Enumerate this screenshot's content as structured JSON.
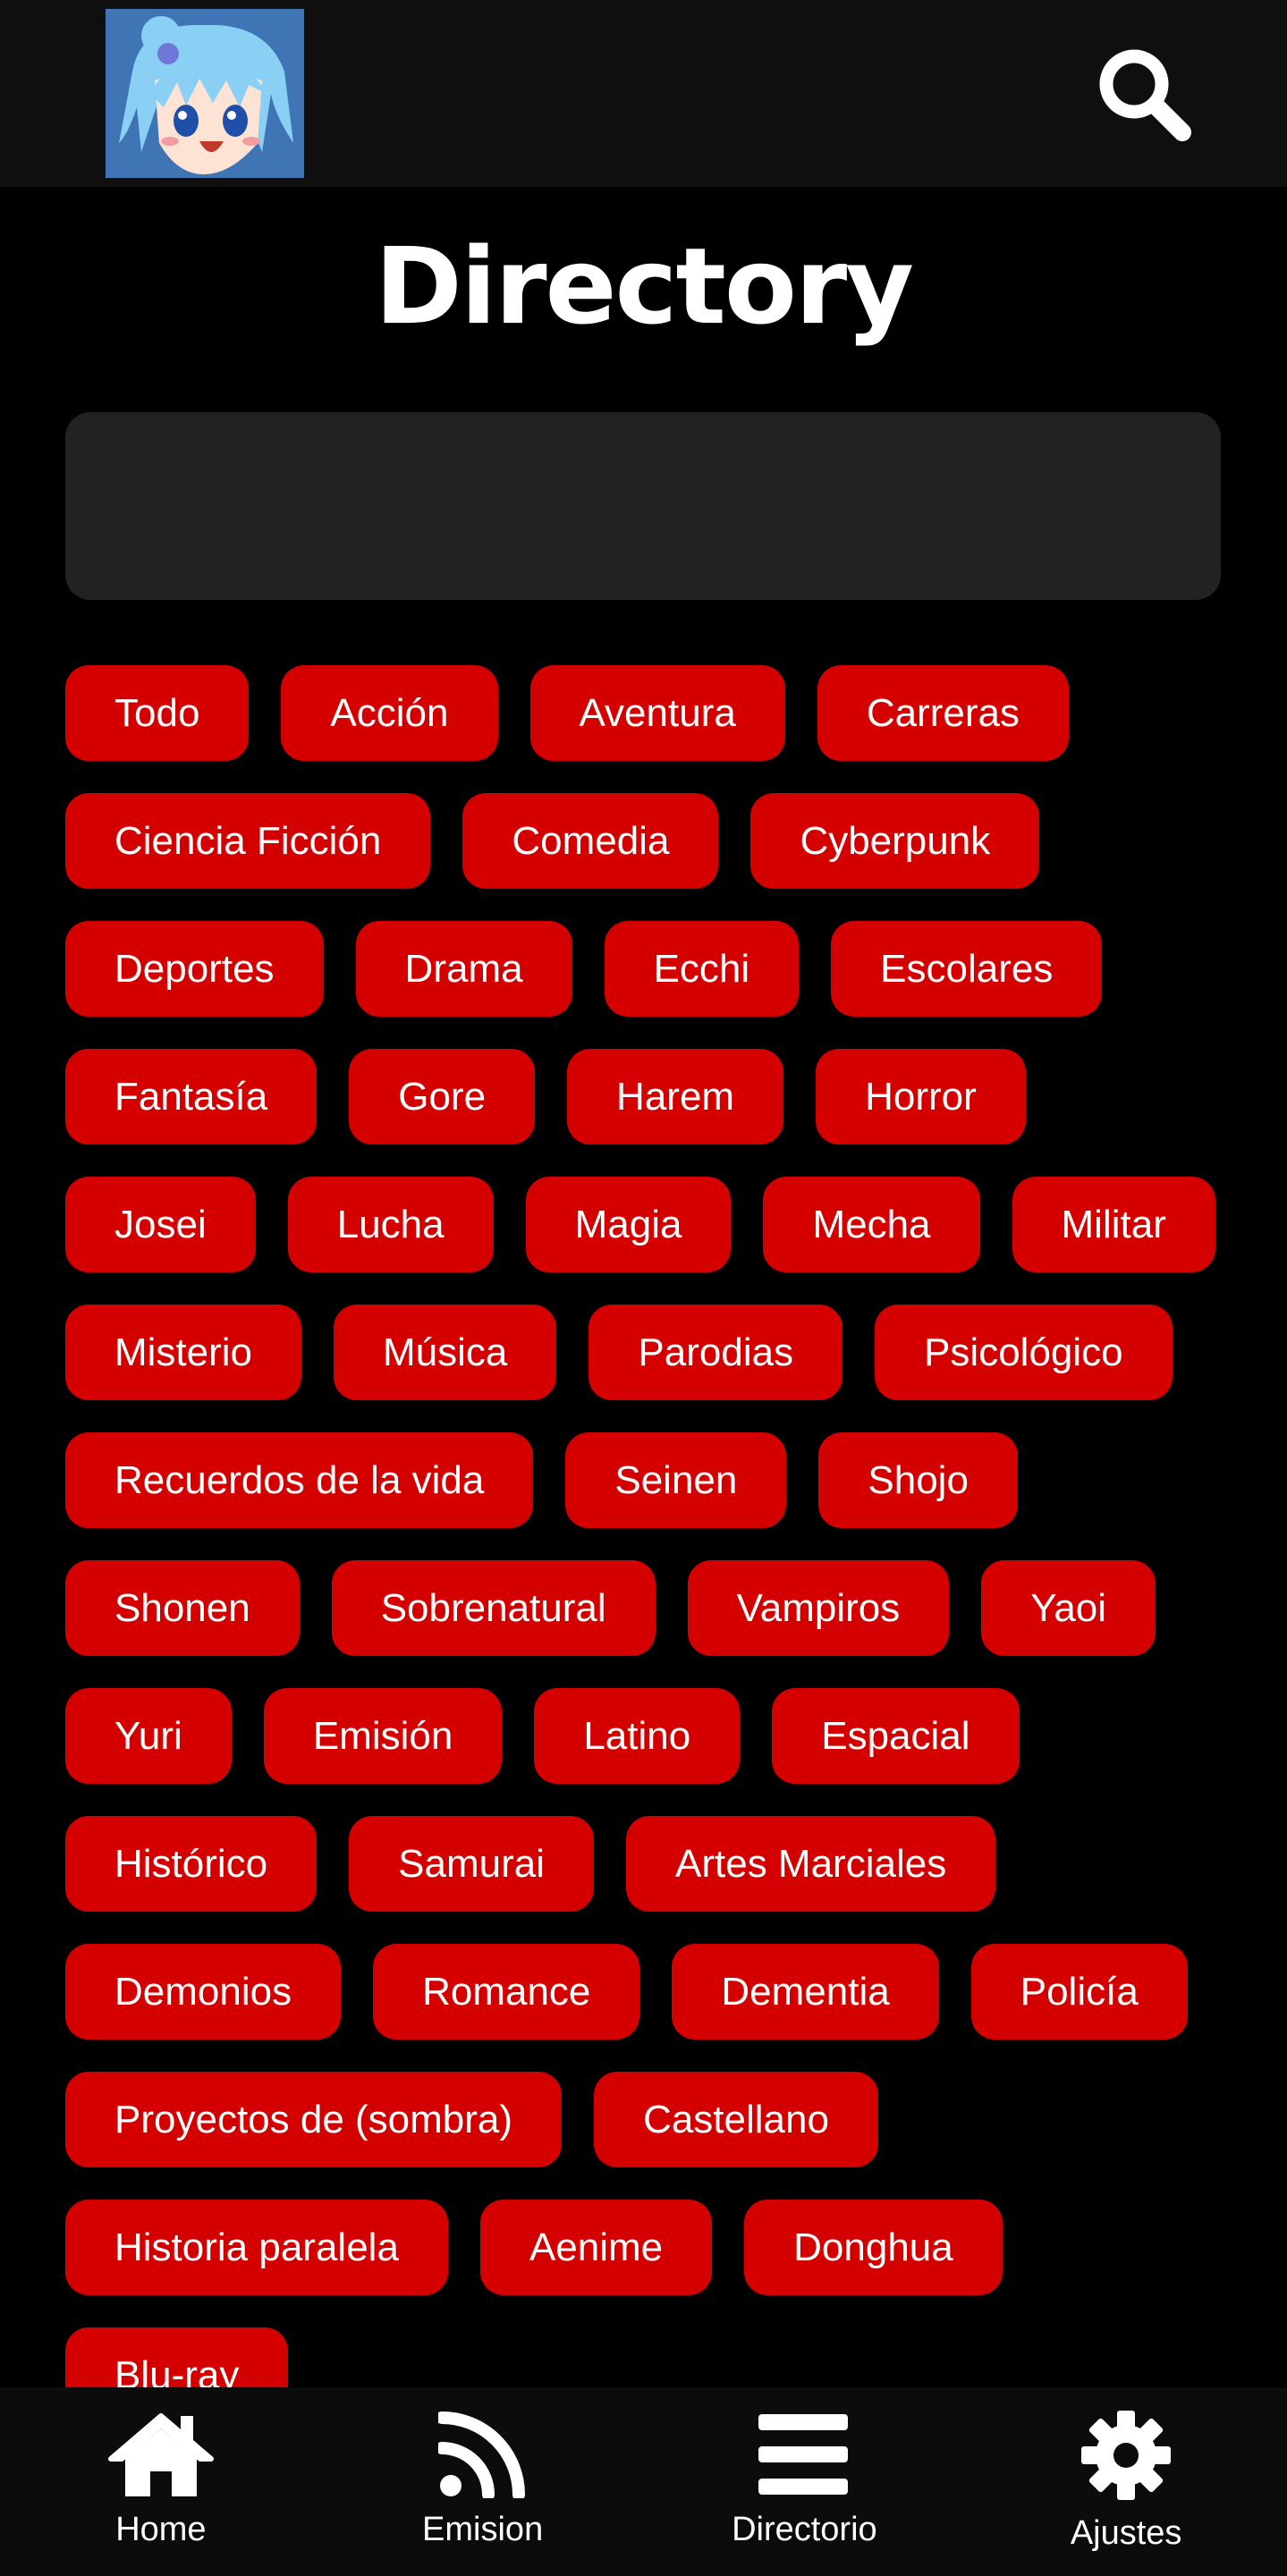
{
  "header": {
    "logo_icon": "anime-avatar-logo",
    "search_icon": "search-icon"
  },
  "page": {
    "title": "Directory"
  },
  "search": {
    "value": "",
    "placeholder": ""
  },
  "genres": [
    "Todo",
    "Acción",
    "Aventura",
    "Carreras",
    "Ciencia Ficción",
    "Comedia",
    "Cyberpunk",
    "Deportes",
    "Drama",
    "Ecchi",
    "Escolares",
    "Fantasía",
    "Gore",
    "Harem",
    "Horror",
    "Josei",
    "Lucha",
    "Magia",
    "Mecha",
    "Militar",
    "Misterio",
    "Música",
    "Parodias",
    "Psicológico",
    "Recuerdos de la vida",
    "Seinen",
    "Shojo",
    "Shonen",
    "Sobrenatural",
    "Vampiros",
    "Yaoi",
    "Yuri",
    "Emisión",
    "Latino",
    "Espacial",
    "Histórico",
    "Samurai",
    "Artes Marciales",
    "Demonios",
    "Romance",
    "Dementia",
    "Policía",
    "Proyectos de (sombra)",
    "Castellano",
    "Historia paralela",
    "Aenime",
    "Donghua",
    "Blu-ray"
  ],
  "bottom_nav": {
    "items": [
      {
        "label": "Home",
        "icon": "home-icon"
      },
      {
        "label": "Emision",
        "icon": "rss-icon"
      },
      {
        "label": "Directorio",
        "icon": "list-icon"
      },
      {
        "label": "Ajustes",
        "icon": "gear-icon"
      }
    ]
  },
  "colors": {
    "tag_background": "#d40000",
    "header_background": "#0f0f0f",
    "search_background": "#222222",
    "page_background": "#000000"
  }
}
